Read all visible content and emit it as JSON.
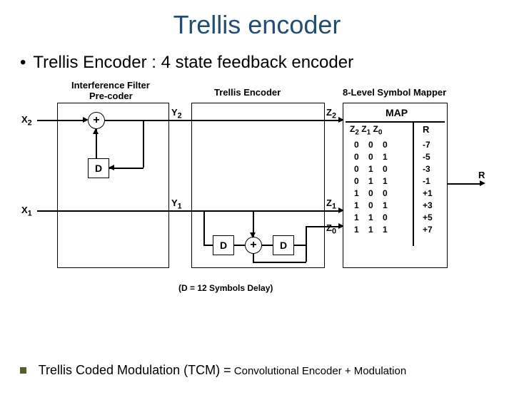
{
  "title": "Trellis encoder",
  "bullet1": "Trellis Encoder : 4 state feedback encoder",
  "diagram": {
    "labels": {
      "precoder_title1": "Interference Filter",
      "precoder_title2": "Pre-coder",
      "trellis_title": "Trellis Encoder",
      "mapper_title": "8-Level Symbol Mapper",
      "x2": "X",
      "x2_sub": "2",
      "x1": "X",
      "x1_sub": "1",
      "y2": "Y",
      "y2_sub": "2",
      "y1": "Y",
      "y1_sub": "1",
      "z2": "Z",
      "z2_sub": "2",
      "z1": "Z",
      "z1_sub": "1",
      "z0": "Z",
      "z0_sub": "0",
      "D": "D",
      "plus": "+",
      "map_heading": "MAP",
      "map_cols": "Z",
      "r_label": "R",
      "delay_note": "(D = 12 Symbols Delay)"
    },
    "mapper": {
      "header_z2": "2",
      "header_z1": "1",
      "header_z0": "0",
      "rows": [
        {
          "bits": [
            "0",
            "0",
            "0"
          ],
          "r": "-7"
        },
        {
          "bits": [
            "0",
            "0",
            "1"
          ],
          "r": "-5"
        },
        {
          "bits": [
            "0",
            "1",
            "0"
          ],
          "r": "-3"
        },
        {
          "bits": [
            "0",
            "1",
            "1"
          ],
          "r": "-1"
        },
        {
          "bits": [
            "1",
            "0",
            "0"
          ],
          "r": "+1"
        },
        {
          "bits": [
            "1",
            "0",
            "1"
          ],
          "r": "+3"
        },
        {
          "bits": [
            "1",
            "1",
            "0"
          ],
          "r": "+5"
        },
        {
          "bits": [
            "1",
            "1",
            "1"
          ],
          "r": "+7"
        }
      ]
    }
  },
  "tcm": {
    "prefix": "Trellis Coded Modulation (TCM) =",
    "suffix": " Convolutional Encoder + Modulation"
  }
}
